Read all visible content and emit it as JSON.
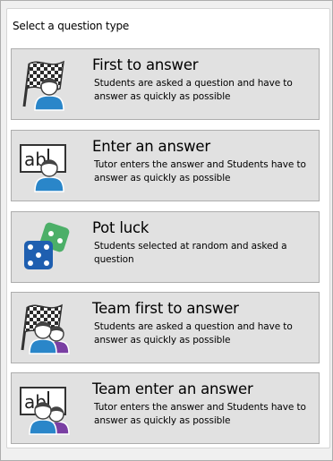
{
  "group": {
    "title": "Select a question type"
  },
  "options": [
    {
      "title": "First to answer",
      "description": "Students are asked a question and have to answer as quickly as possible",
      "icon": "checkered-flag-student-icon"
    },
    {
      "title": "Enter an answer",
      "description": "Tutor enters the answer and Students have to answer as quickly as possible",
      "icon": "text-box-student-icon"
    },
    {
      "title": "Pot luck",
      "description": "Students selected at random and asked a question",
      "icon": "dice-icon"
    },
    {
      "title": "Team first to answer",
      "description": "Students are asked a question and have to answer as quickly as possible",
      "icon": "checkered-flag-team-icon"
    },
    {
      "title": "Team enter an answer",
      "description": "Tutor enters the answer and Students have to answer as quickly as possible",
      "icon": "text-box-team-icon"
    }
  ],
  "icon_text": "ab",
  "colors": {
    "student_blue": "#2a86c9",
    "team_purple": "#7a3fa3",
    "dice_blue": "#1f5fb0",
    "dice_green": "#4caf68"
  }
}
